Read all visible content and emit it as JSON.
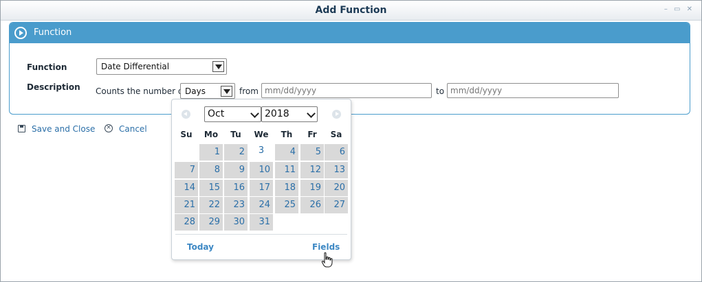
{
  "window": {
    "title": "Add Function",
    "controls": "– ▭ ✕"
  },
  "panel": {
    "title": "Function"
  },
  "form": {
    "function_label": "Function",
    "function_value": "Date Differential",
    "description_label": "Description",
    "counts_text": "Counts the number of",
    "unit_value": "Days",
    "from_text": "from",
    "from_placeholder": "mm/dd/yyyy",
    "to_text": "to",
    "to_placeholder": "mm/dd/yyyy"
  },
  "actions": {
    "save_label": "Save and Close",
    "cancel_label": "Cancel"
  },
  "calendar": {
    "month": "Oct",
    "year": "2018",
    "weekdays": [
      "Su",
      "Mo",
      "Tu",
      "We",
      "Th",
      "Fr",
      "Sa"
    ],
    "days": [
      "1",
      "2",
      "3",
      "4",
      "5",
      "6",
      "7",
      "8",
      "9",
      "10",
      "11",
      "12",
      "13",
      "14",
      "15",
      "16",
      "17",
      "18",
      "19",
      "20",
      "21",
      "22",
      "23",
      "24",
      "25",
      "26",
      "27",
      "28",
      "29",
      "30",
      "31"
    ],
    "today": "3",
    "today_label": "Today",
    "fields_label": "Fields"
  }
}
